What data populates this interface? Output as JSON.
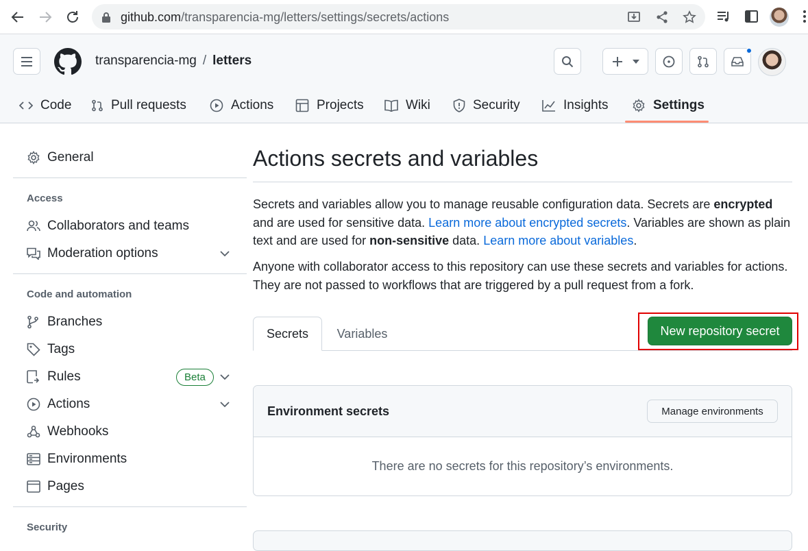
{
  "browser": {
    "url_host": "github.com",
    "url_path": "/transparencia-mg/letters/settings/secrets/actions"
  },
  "header": {
    "owner": "transparencia-mg",
    "separator": "/",
    "repo": "letters"
  },
  "repo_tabs": [
    "Code",
    "Pull requests",
    "Actions",
    "Projects",
    "Wiki",
    "Security",
    "Insights",
    "Settings"
  ],
  "sidebar": {
    "general": "General",
    "access_heading": "Access",
    "collaborators": "Collaborators and teams",
    "moderation": "Moderation options",
    "code_heading": "Code and automation",
    "branches": "Branches",
    "tags": "Tags",
    "rules": "Rules",
    "beta": "Beta",
    "actions": "Actions",
    "webhooks": "Webhooks",
    "environments": "Environments",
    "pages": "Pages",
    "security_heading": "Security"
  },
  "main": {
    "title": "Actions secrets and variables",
    "p1_a": "Secrets and variables allow you to manage reusable configuration data. Secrets are ",
    "p1_b": "encrypted",
    "p1_c": " and are used for sensitive data. ",
    "p1_link1": "Learn more about encrypted secrets",
    "p1_d": ". Variables are shown as plain text and are used for ",
    "p1_e": "non-sensitive",
    "p1_f": " data. ",
    "p1_link2": "Learn more about variables",
    "p1_g": ".",
    "p2": "Anyone with collaborator access to this repository can use these secrets and variables for actions. They are not passed to workflows that are triggered by a pull request from a fork.",
    "tab_secrets": "Secrets",
    "tab_variables": "Variables",
    "new_secret_button": "New repository secret",
    "env_title": "Environment secrets",
    "manage_env_button": "Manage environments",
    "env_empty": "There are no secrets for this repository’s environments."
  },
  "colors": {
    "primary_button": "#1f883d",
    "link": "#0969da",
    "highlight": "#e00000",
    "selected_tab_underline": "#fd8c73"
  }
}
